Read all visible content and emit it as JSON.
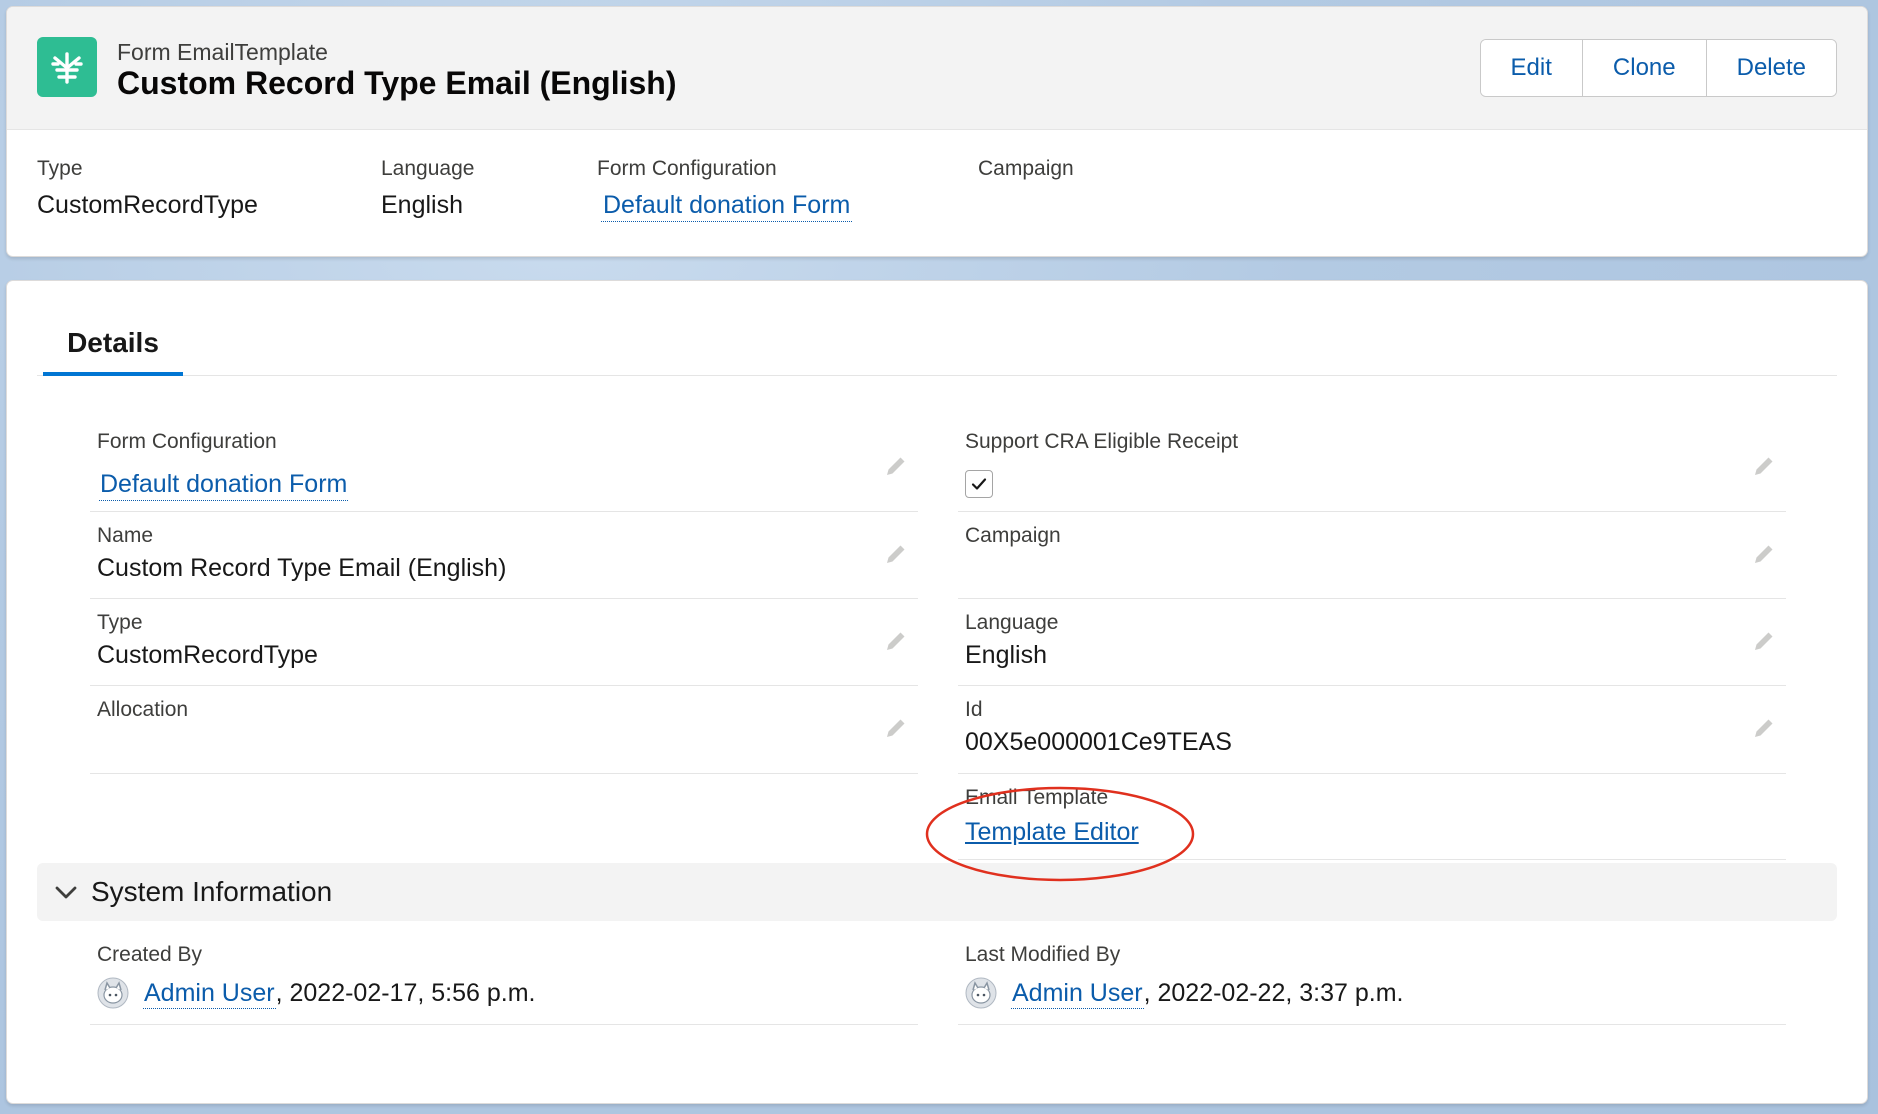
{
  "header": {
    "object_type": "Form EmailTemplate",
    "title": "Custom Record Type Email (English)",
    "icon": "form-email-template-icon",
    "buttons": {
      "edit": "Edit",
      "clone": "Clone",
      "delete": "Delete"
    },
    "highlights": {
      "type_label": "Type",
      "type_value": "CustomRecordType",
      "language_label": "Language",
      "language_value": "English",
      "form_config_label": "Form Configuration",
      "form_config_value": "Default donation Form",
      "campaign_label": "Campaign",
      "campaign_value": ""
    }
  },
  "tabs": {
    "details": "Details"
  },
  "details": {
    "form_configuration": {
      "label": "Form Configuration",
      "value": "Default donation Form"
    },
    "support_cra": {
      "label": "Support CRA Eligible Receipt",
      "checked": true
    },
    "name": {
      "label": "Name",
      "value": "Custom Record Type Email (English)"
    },
    "campaign": {
      "label": "Campaign",
      "value": ""
    },
    "type": {
      "label": "Type",
      "value": "CustomRecordType"
    },
    "language": {
      "label": "Language",
      "value": "English"
    },
    "allocation": {
      "label": "Allocation",
      "value": ""
    },
    "id": {
      "label": "Id",
      "value": "00X5e000001Ce9TEAS"
    },
    "email_template": {
      "label": "Email Template",
      "value": "Template Editor"
    }
  },
  "system_information": {
    "title": "System Information",
    "created_by": {
      "label": "Created By",
      "user": "Admin User",
      "date": ", 2022-02-17, 5:56 p.m."
    },
    "last_modified_by": {
      "label": "Last Modified By",
      "user": "Admin User",
      "date": ", 2022-02-22, 3:37 p.m."
    }
  },
  "colors": {
    "brand_icon": "#2ebd93",
    "link": "#0b5cab",
    "tab_underline": "#0176d3",
    "annotation": "#e0301e"
  }
}
